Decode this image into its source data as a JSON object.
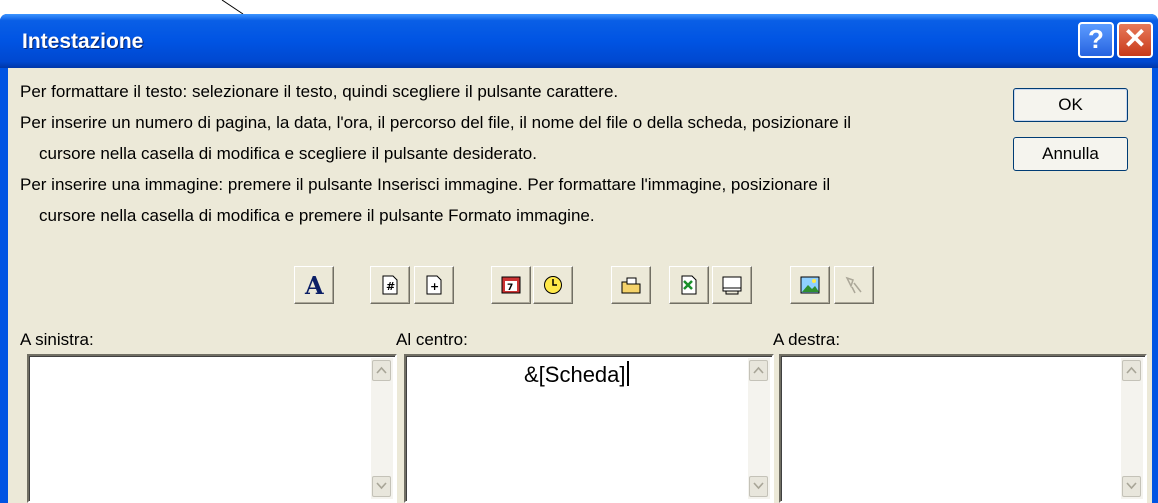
{
  "window": {
    "title": "Intestazione"
  },
  "titlebar": {
    "help_label": "?",
    "close_label": "✕"
  },
  "instructions": [
    "Per formattare il testo: selezionare il testo, quindi scegliere il pulsante carattere.",
    "Per inserire un numero di pagina, la data, l'ora, il percorso del file, il nome del file o della scheda, posizionare il",
    "cursore nella casella di modifica e scegliere il pulsante desiderato.",
    "Per inserire una immagine: premere il pulsante Inserisci immagine. Per formattare l'immagine, posizionare il",
    "cursore nella casella di modifica e premere il pulsante Formato immagine."
  ],
  "buttons": {
    "ok": "OK",
    "cancel": "Annulla"
  },
  "toolbar": {
    "font_glyph": "A",
    "icons": [
      "font-icon",
      "page-number-icon",
      "total-pages-icon",
      "date-icon",
      "time-icon",
      "file-path-icon",
      "file-name-icon",
      "sheet-name-icon",
      "insert-picture-icon",
      "format-picture-icon"
    ]
  },
  "sections": {
    "left": {
      "label": "A sinistra:",
      "value": ""
    },
    "center": {
      "label": "Al centro:",
      "value": "&[Scheda]"
    },
    "right": {
      "label": "A destra:",
      "value": ""
    }
  },
  "colors": {
    "title_bar": "#0054e3",
    "dialog_bg": "#ece9d8",
    "close_button": "#c73a1a"
  }
}
